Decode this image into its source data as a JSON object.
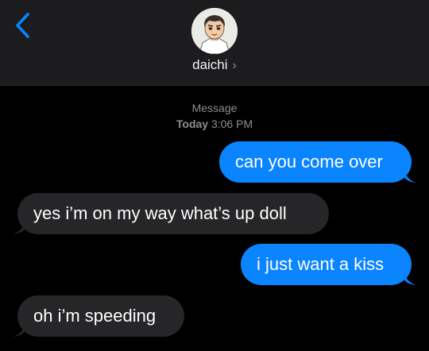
{
  "header": {
    "back_icon": "chevron-left-icon",
    "contact_name": "daichi",
    "chevron": "›",
    "accent": "#0a84ff"
  },
  "conversation": {
    "service": "Message",
    "day": "Today",
    "time": "3:06 PM"
  },
  "messages": [
    {
      "direction": "outgoing",
      "text": "can you come over"
    },
    {
      "direction": "incoming",
      "text": "yes i’m on my way what’s up doll"
    },
    {
      "direction": "outgoing",
      "text": "i just want a kiss"
    },
    {
      "direction": "incoming",
      "text": "oh i’m speeding"
    }
  ],
  "colors": {
    "outgoing_bubble": "#0a84ff",
    "incoming_bubble": "#262628",
    "background": "#000000",
    "header": "#1c1c1e"
  }
}
